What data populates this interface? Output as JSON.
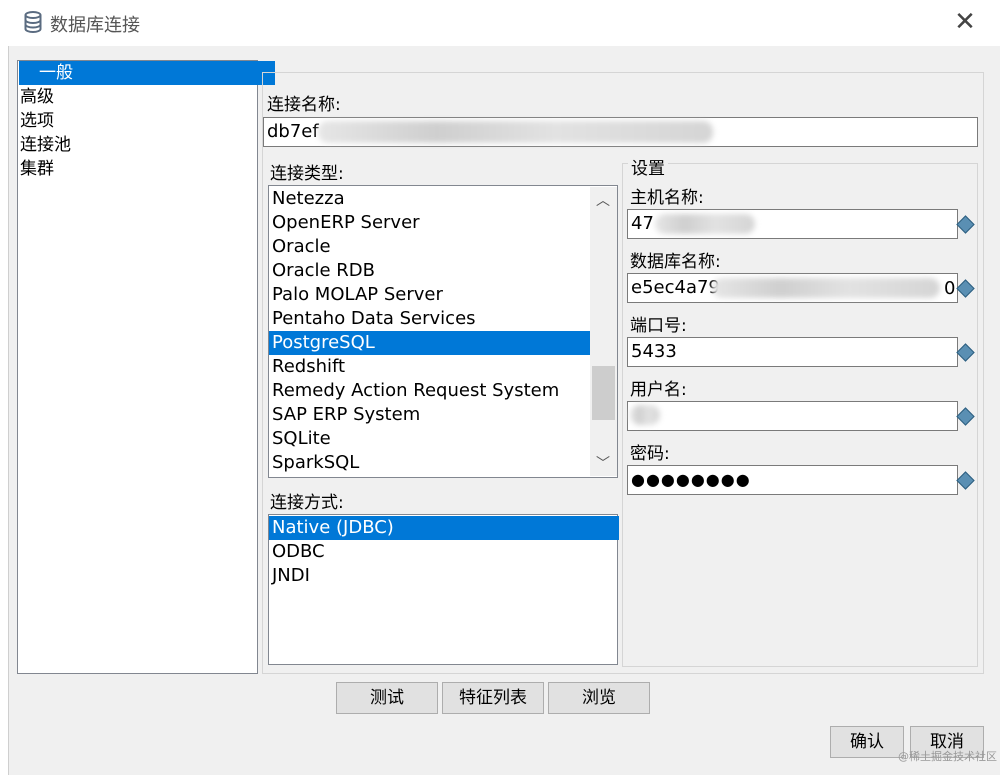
{
  "window": {
    "title": "数据库连接"
  },
  "nav": {
    "items": [
      "一般",
      "高级",
      "选项",
      "连接池",
      "集群"
    ],
    "selected": 0
  },
  "connection_name": {
    "label": "连接名称:",
    "value": "db7ef"
  },
  "connection_type": {
    "label": "连接类型:",
    "items": [
      "Netezza",
      "OpenERP Server",
      "Oracle",
      "Oracle RDB",
      "Palo MOLAP Server",
      "Pentaho Data Services",
      "PostgreSQL",
      "Redshift",
      "Remedy Action Request System",
      "SAP ERP System",
      "SQLite",
      "SparkSQL"
    ],
    "selected": 6
  },
  "access_method": {
    "label": "连接方式:",
    "items": [
      "Native (JDBC)",
      "ODBC",
      "JNDI"
    ],
    "selected": 0
  },
  "settings": {
    "group_label": "设置",
    "host": {
      "label": "主机名称:",
      "value": "47"
    },
    "database": {
      "label": "数据库名称:",
      "value": "e5ec4a79",
      "suffix": "0"
    },
    "port": {
      "label": "端口号:",
      "value": "5433"
    },
    "user": {
      "label": "用户名:",
      "value": ""
    },
    "password": {
      "label": "密码:",
      "value": "●●●●●●●●"
    }
  },
  "buttons": {
    "test": "测试",
    "features": "特征列表",
    "explore": "浏览",
    "ok": "确认",
    "cancel": "取消"
  },
  "watermark": "@稀土掘金技术社区"
}
